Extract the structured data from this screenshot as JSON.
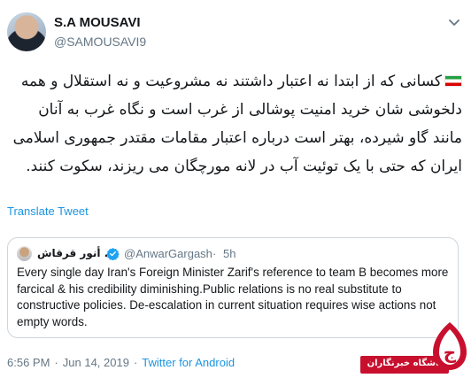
{
  "tweet": {
    "author_name": "S.A MOUSAVI",
    "author_handle": "@SAMOUSAVI9",
    "text": "کسانی که از ابتدا نه اعتبار داشتند نه مشروعیت و نه استقلال و همه دلخوشی شان خرید امنیت پوشالی از غرب است و نگاه غرب به آنان مانند گاو شیرده، بهتر است درباره اعتبار مقامات مقتدر جمهوری اسلامی ایران که حتی با یک توئیت آب در لانه مورچگان می ریزند، سکوت کنند.",
    "flag_icon": "iran-flag-icon",
    "translate_label": "Translate Tweet",
    "time": "6:56 PM",
    "date": "Jun 14, 2019",
    "source": "Twitter for Android",
    "separator": "·"
  },
  "quoted": {
    "author_name": "د. أنور قرقاش",
    "handle": "@AnwarGargash",
    "separator": "·",
    "time": "5h",
    "text": "Every single day Iran's Foreign Minister Zarif's reference to team B becomes more farcical & his credibility diminishing.Public relations is no real substitute to constructive policies. De-escalation in current situation requires wise actions not empty words."
  },
  "watermark": {
    "text": "باشگاه خبرنگاران",
    "logo_glyph": "ج"
  },
  "colors": {
    "link": "#1b95e0",
    "secondary": "#657786",
    "watermark_red": "#c8102e",
    "verified_blue": "#1da1f2"
  }
}
